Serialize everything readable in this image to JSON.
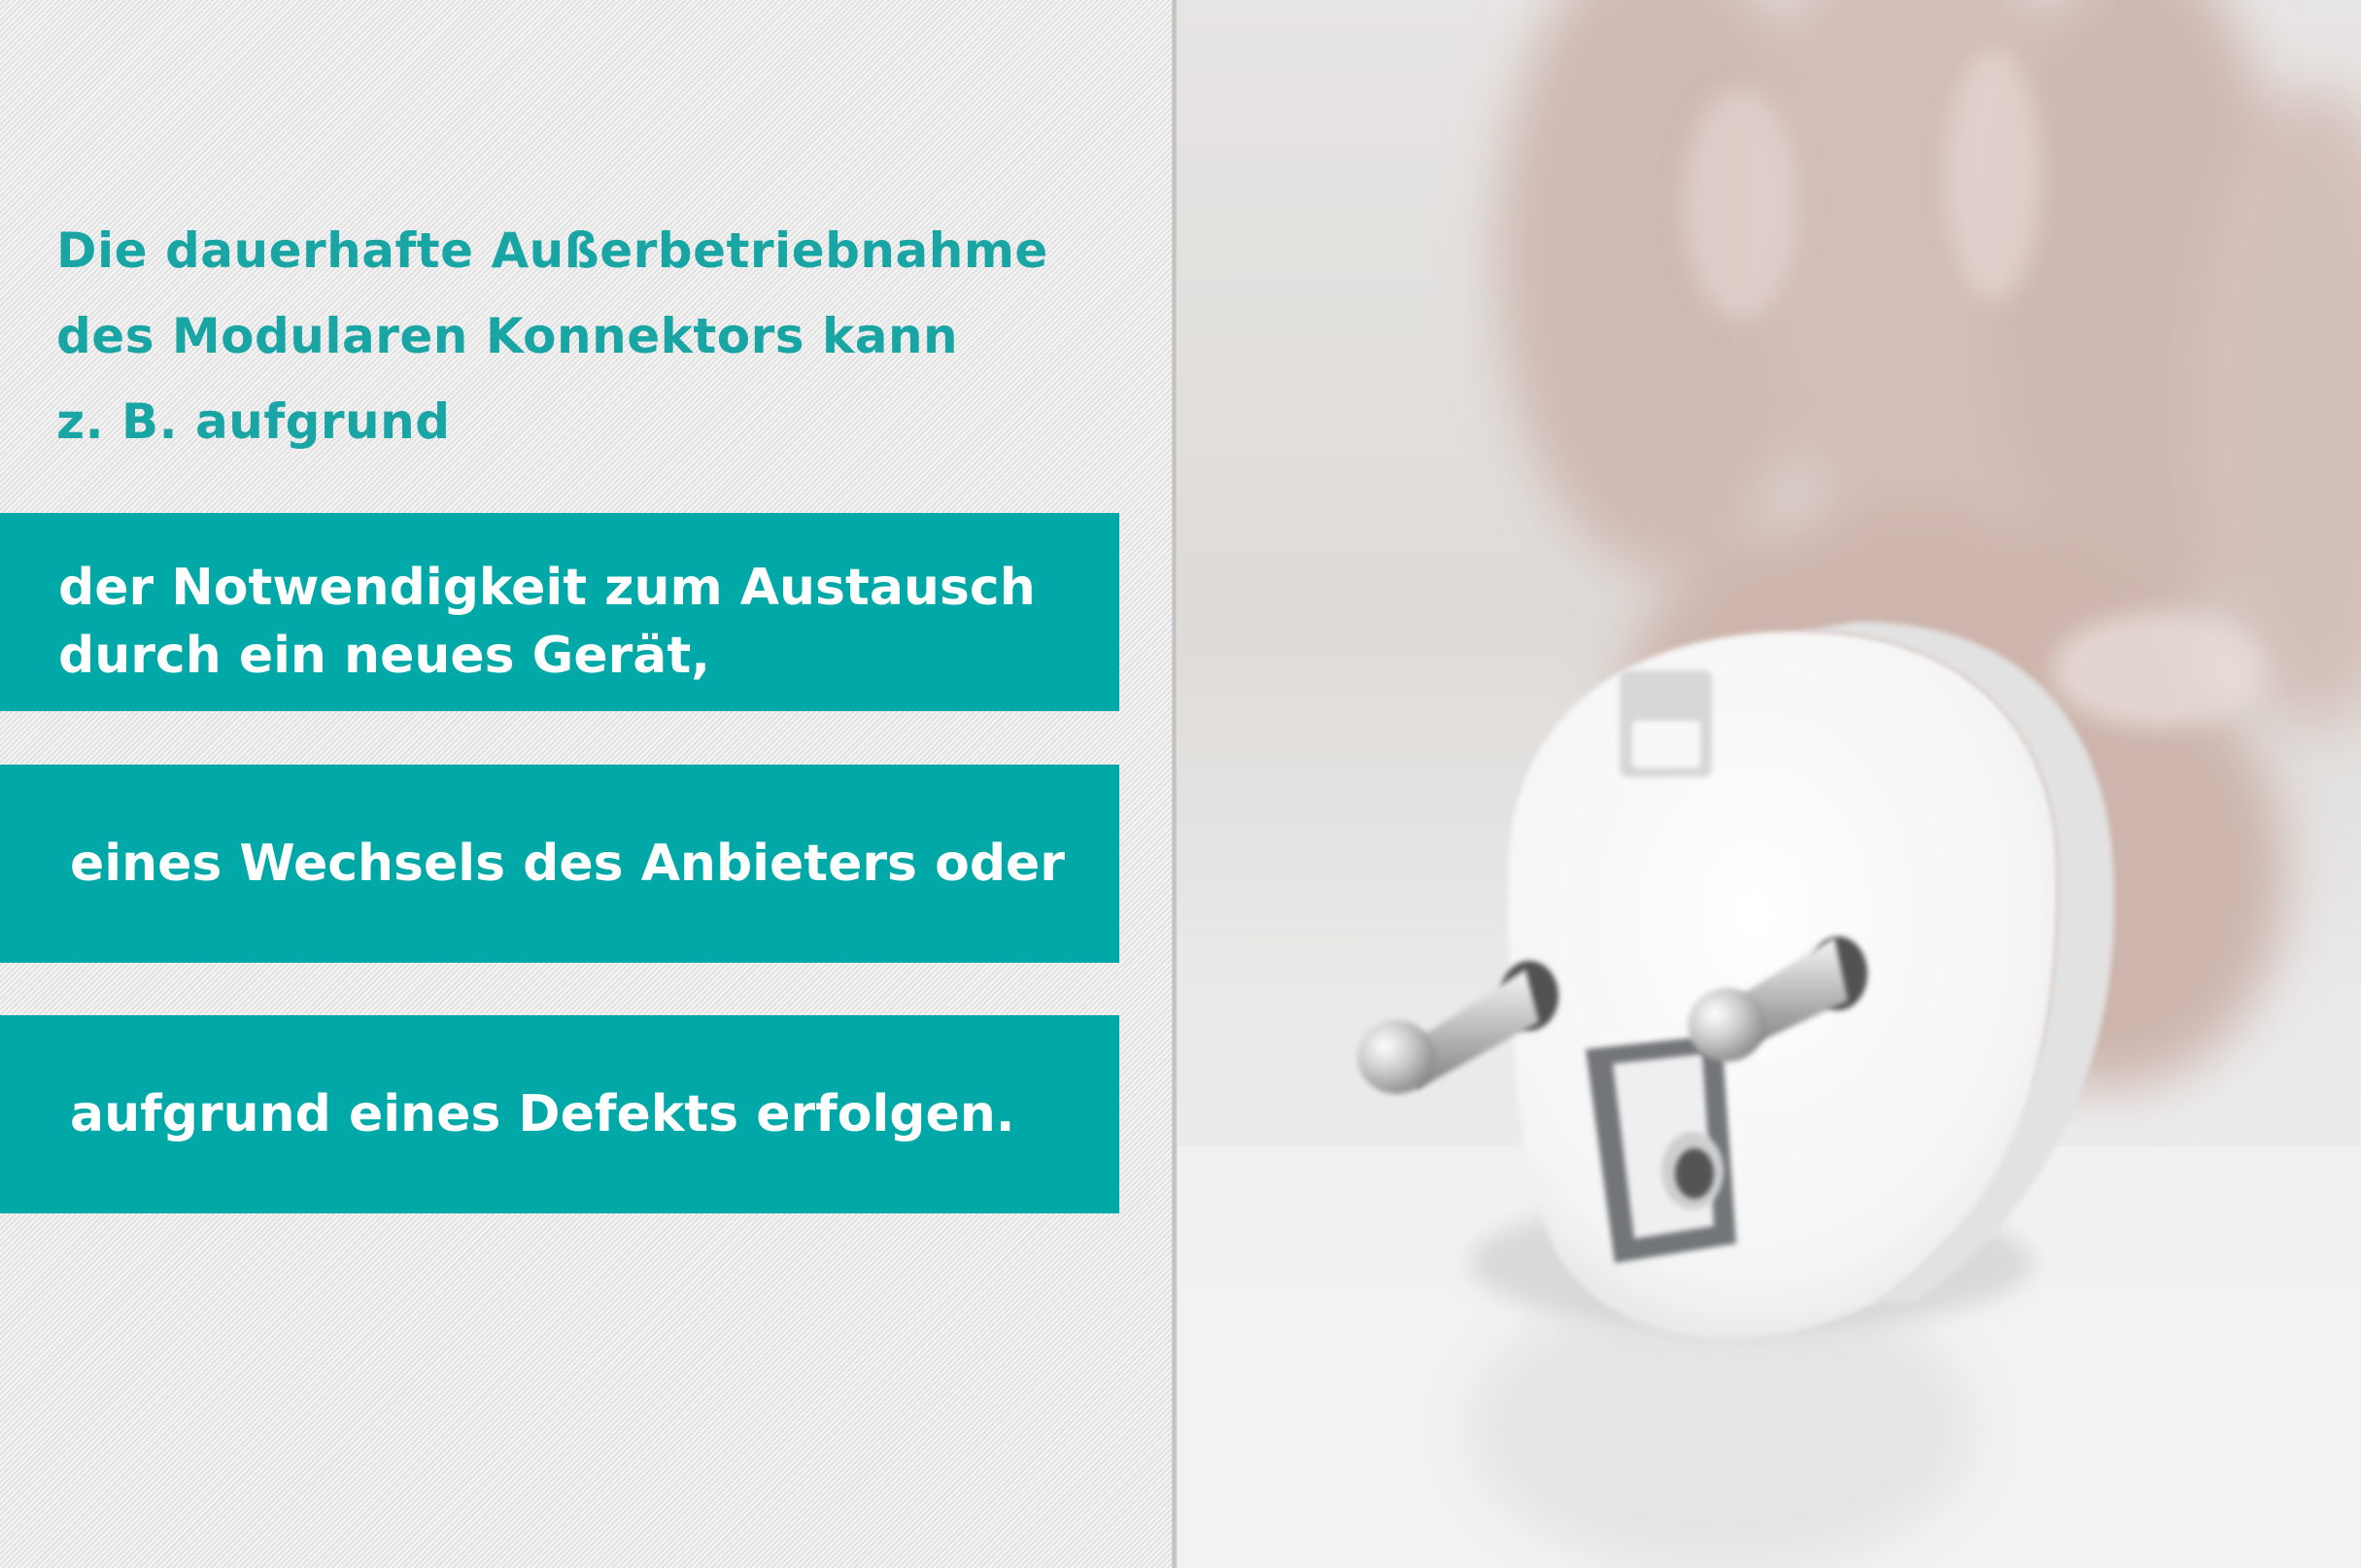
{
  "intro": {
    "lines": [
      "Die dauerhafte Außerbetriebnahme",
      "des Modularen Konnektors kann",
      "z. B. aufgrund"
    ]
  },
  "reasons": [
    {
      "lines": [
        "der Notwendigkeit zum Austausch",
        "durch ein neues Gerät,"
      ]
    },
    {
      "lines": [
        "eines Wechsels des Anbieters oder"
      ]
    },
    {
      "lines": [
        "aufgrund eines Defekts erfolgen."
      ]
    }
  ],
  "colors": {
    "accent": "#00a8a8",
    "intro_text": "#1aa5a5",
    "box_text": "#ffffff",
    "panel_background": "#e9e9e9"
  },
  "photo": {
    "subject": "hand-holding-power-plug"
  }
}
